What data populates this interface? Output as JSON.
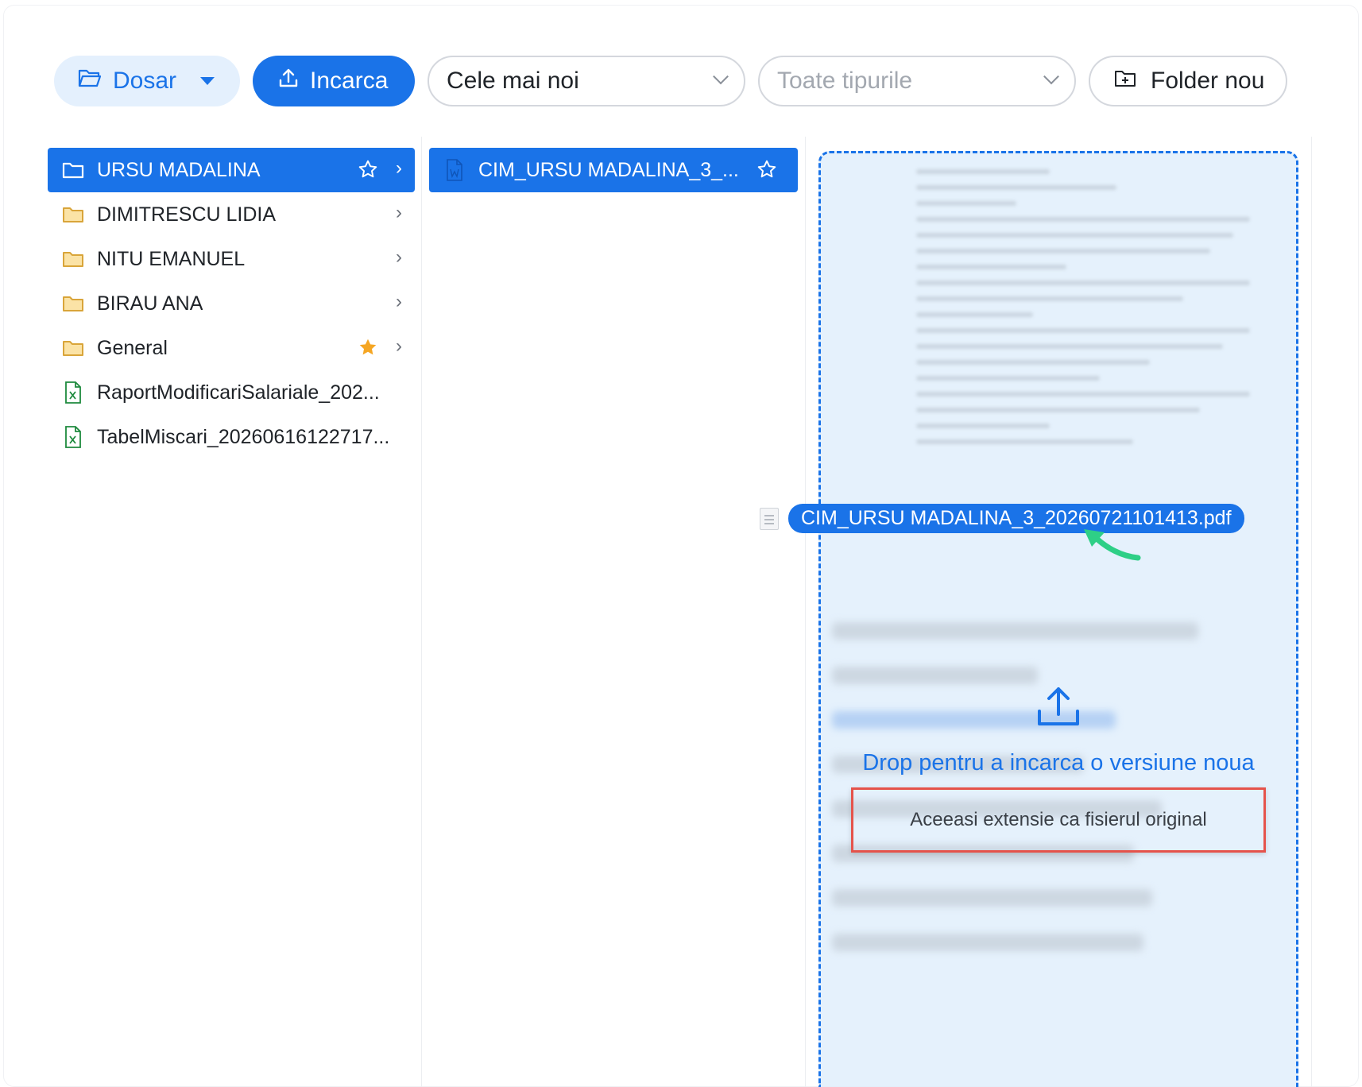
{
  "toolbar": {
    "dosar_label": "Dosar",
    "upload_label": "Incarca",
    "sort_select": {
      "value": "Cele mai noi"
    },
    "type_select": {
      "placeholder": "Toate tipurile"
    },
    "new_folder_label": "Folder nou"
  },
  "column1": {
    "items": [
      {
        "name": "URSU MADALINA",
        "type": "folder",
        "selected": true,
        "starred": false
      },
      {
        "name": "DIMITRESCU LIDIA",
        "type": "folder",
        "selected": false
      },
      {
        "name": "NITU EMANUEL",
        "type": "folder",
        "selected": false
      },
      {
        "name": "BIRAU ANA",
        "type": "folder",
        "selected": false
      },
      {
        "name": "General",
        "type": "folder",
        "selected": false,
        "starred": true
      },
      {
        "name": "RaportModificariSalariale_202...",
        "type": "excel"
      },
      {
        "name": "TabelMiscari_20260616122717...",
        "type": "excel"
      }
    ]
  },
  "column2": {
    "items": [
      {
        "name": "CIM_URSU MADALINA_3_...",
        "type": "word",
        "selected": true
      }
    ]
  },
  "dragged_file": {
    "name": "CIM_URSU MADALINA_3_20260721101413.pdf"
  },
  "dropzone": {
    "title": "Drop pentru a incarca o versiune noua",
    "hint": "Aceeasi extensie ca fisierul original"
  },
  "colors": {
    "accent": "#1a73e8",
    "highlight_box": "#e5534b",
    "star": "#f5a623",
    "excel": "#1e8a3e"
  }
}
